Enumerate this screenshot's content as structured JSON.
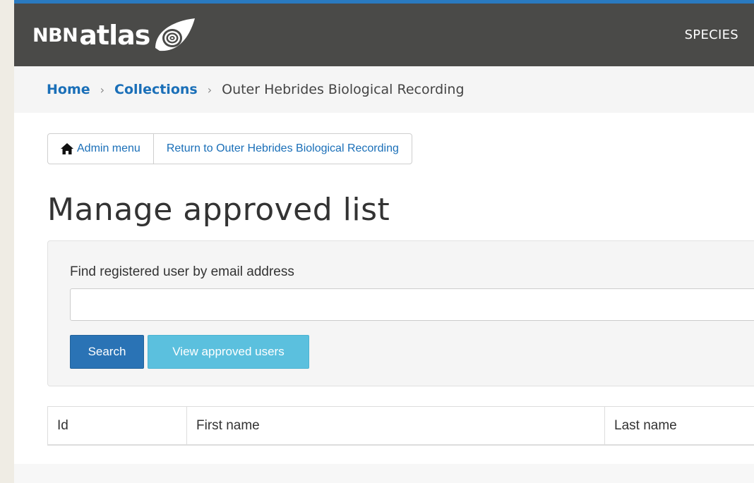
{
  "header": {
    "logo_nbn": "NBN",
    "logo_atlas": "atlas",
    "nav_species": "SPECIES",
    "accent_color": "#2a7ac0",
    "background_color": "#4a4a48"
  },
  "breadcrumb": {
    "home": "Home",
    "collections": "Collections",
    "current": "Outer Hebrides Biological Recording",
    "separator": "›"
  },
  "admin_buttons": {
    "admin_menu": "Admin menu",
    "admin_menu_icon": "home-icon",
    "return_label": "Return to Outer Hebrides Biological Recording"
  },
  "page": {
    "title": "Manage approved list"
  },
  "search_panel": {
    "label": "Find registered user by email address",
    "input_value": "",
    "search_button": "Search",
    "view_button": "View approved users",
    "search_color": "#2a73b5",
    "view_color": "#5bc0de"
  },
  "table": {
    "columns": [
      "Id",
      "First name",
      "Last name"
    ]
  }
}
